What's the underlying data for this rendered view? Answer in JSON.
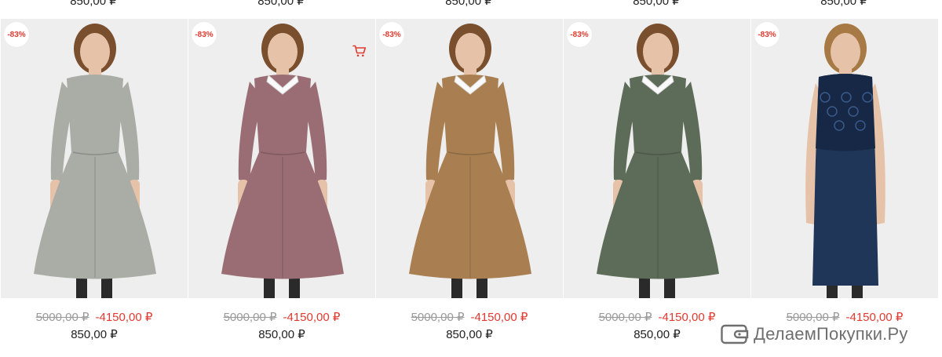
{
  "top_row": {
    "prices": [
      "850,00 ₽",
      "850,00 ₽",
      "850,00 ₽",
      "850,00 ₽",
      "850,00 ₽"
    ]
  },
  "products": [
    {
      "badge": "-83%",
      "old_price": "5000,00 ₽",
      "discount": "-4150,00 ₽",
      "price": "850,00 ₽",
      "dress_color": "#a9ada6",
      "collar": false,
      "lace_top": false,
      "cart_icon": false
    },
    {
      "badge": "-83%",
      "old_price": "5000,00 ₽",
      "discount": "-4150,00 ₽",
      "price": "850,00 ₽",
      "dress_color": "#9a6d74",
      "collar": true,
      "lace_top": false,
      "cart_icon": true
    },
    {
      "badge": "-83%",
      "old_price": "5000,00 ₽",
      "discount": "-4150,00 ₽",
      "price": "850,00 ₽",
      "dress_color": "#a97f52",
      "collar": true,
      "lace_top": false,
      "cart_icon": false
    },
    {
      "badge": "-83%",
      "old_price": "5000,00 ₽",
      "discount": "-4150,00 ₽",
      "price": "850,00 ₽",
      "dress_color": "#5d6b59",
      "collar": true,
      "lace_top": false,
      "cart_icon": false
    },
    {
      "badge": "-83%",
      "old_price": "5000,00 ₽",
      "discount": "-4150,00 ₽",
      "price": "",
      "dress_color": "#1f3659",
      "collar": false,
      "lace_top": true,
      "cart_icon": false
    }
  ],
  "colors": {
    "accent_red": "#e03a2f",
    "old_price_gray": "#9a9a9a",
    "photo_bg": "#eeeeee"
  },
  "icons": {
    "cart": "shopping-cart-icon",
    "wallet": "wallet-icon"
  },
  "watermark": {
    "text": "ДелаемПокупки.Ру"
  }
}
